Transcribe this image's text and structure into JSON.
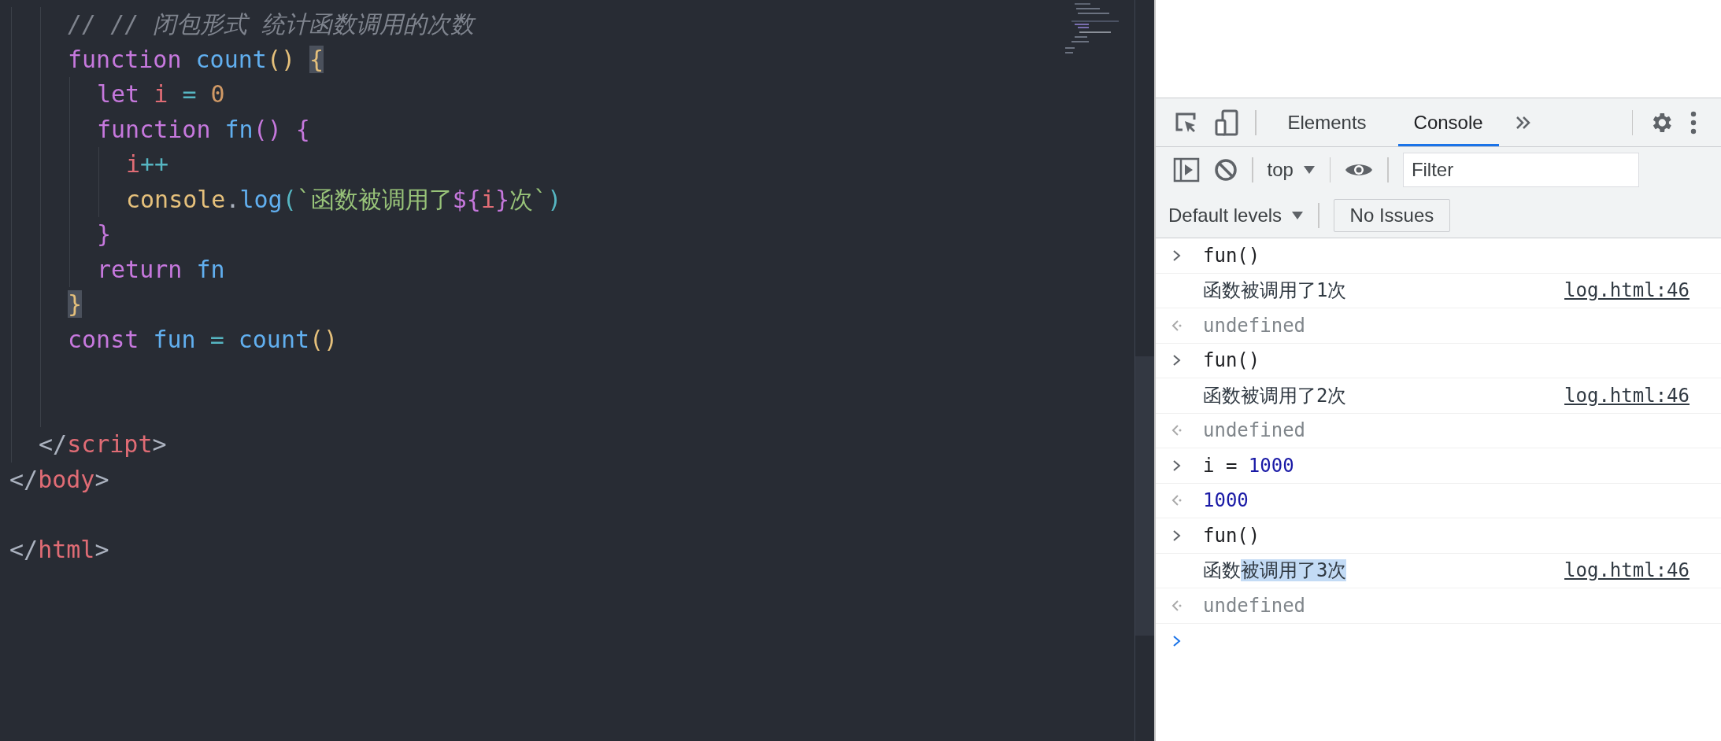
{
  "editor": {
    "lines": [
      {
        "kind": "group",
        "children": [
          {
            "kind": "group",
            "children": [
              {
                "kind": "code",
                "tokens": [
                  {
                    "text": "// // 闭包形式 统计函数调用的次数",
                    "kind": "comment"
                  }
                ]
              },
              {
                "kind": "code",
                "tokens": [
                  {
                    "text": "function ",
                    "kind": "keyword"
                  },
                  {
                    "text": "count",
                    "kind": "func"
                  },
                  {
                    "text": "() ",
                    "kind": "paren"
                  },
                  {
                    "text": "{",
                    "kind": "match"
                  }
                ],
                "children": [
                  {
                    "kind": "code",
                    "tokens": [
                      {
                        "text": "let ",
                        "kind": "keyword"
                      },
                      {
                        "text": "i ",
                        "kind": "var"
                      },
                      {
                        "text": "= ",
                        "kind": "op"
                      },
                      {
                        "text": "0",
                        "kind": "number"
                      }
                    ]
                  },
                  {
                    "kind": "code",
                    "tokens": [
                      {
                        "text": "function ",
                        "kind": "keyword"
                      },
                      {
                        "text": "fn",
                        "kind": "func"
                      },
                      {
                        "text": "() {",
                        "kind": "brace"
                      }
                    ],
                    "children": [
                      {
                        "kind": "code",
                        "tokens": [
                          {
                            "text": "i",
                            "kind": "var"
                          },
                          {
                            "text": "++",
                            "kind": "op"
                          }
                        ]
                      },
                      {
                        "kind": "code",
                        "tokens": [
                          {
                            "text": "console",
                            "kind": "object"
                          },
                          {
                            "text": ".",
                            "kind": "plain"
                          },
                          {
                            "text": "log",
                            "kind": "func"
                          },
                          {
                            "text": "(",
                            "kind": "op"
                          },
                          {
                            "text": "`函数被调用了",
                            "kind": "string"
                          },
                          {
                            "text": "${",
                            "kind": "keyword"
                          },
                          {
                            "text": "i",
                            "kind": "var"
                          },
                          {
                            "text": "}",
                            "kind": "keyword"
                          },
                          {
                            "text": "次`",
                            "kind": "string"
                          },
                          {
                            "text": ")",
                            "kind": "op"
                          }
                        ]
                      }
                    ]
                  },
                  {
                    "kind": "code",
                    "tokens": [
                      {
                        "text": "}",
                        "kind": "brace"
                      }
                    ]
                  },
                  {
                    "kind": "code",
                    "tokens": [
                      {
                        "text": "return ",
                        "kind": "keyword"
                      },
                      {
                        "text": "fn",
                        "kind": "func"
                      }
                    ]
                  }
                ]
              },
              {
                "kind": "code",
                "tokens": [
                  {
                    "text": "}",
                    "kind": "match"
                  }
                ]
              },
              {
                "kind": "code",
                "tokens": [
                  {
                    "text": "const ",
                    "kind": "keyword"
                  },
                  {
                    "text": "fun ",
                    "kind": "func"
                  },
                  {
                    "text": "= ",
                    "kind": "op"
                  },
                  {
                    "text": "count",
                    "kind": "func"
                  },
                  {
                    "text": "()",
                    "kind": "paren"
                  }
                ]
              },
              {
                "kind": "blank"
              },
              {
                "kind": "blank"
              }
            ]
          },
          {
            "kind": "code",
            "tokens": [
              {
                "text": "</",
                "kind": "plain"
              },
              {
                "text": "script",
                "kind": "tag"
              },
              {
                "text": ">",
                "kind": "plain"
              }
            ]
          }
        ]
      },
      {
        "kind": "code",
        "tokens": [
          {
            "text": "</",
            "kind": "plain"
          },
          {
            "text": "body",
            "kind": "tag"
          },
          {
            "text": ">",
            "kind": "plain"
          }
        ]
      },
      {
        "kind": "blank"
      },
      {
        "kind": "code",
        "tokens": [
          {
            "text": "</",
            "kind": "plain"
          },
          {
            "text": "html",
            "kind": "tag"
          },
          {
            "text": ">",
            "kind": "plain"
          }
        ]
      }
    ]
  },
  "devtools": {
    "tabs": [
      {
        "label": "Elements",
        "selected": false
      },
      {
        "label": "Console",
        "selected": true
      }
    ],
    "context": "top",
    "filter": {
      "placeholder": "Filter"
    },
    "levels": "Default levels",
    "issues": "No Issues",
    "console": [
      {
        "kind": "input",
        "tokens": [
          {
            "text": "fun()",
            "kind": "plain"
          }
        ]
      },
      {
        "kind": "log",
        "text": "函数被调用了1次",
        "source": "log.html:46"
      },
      {
        "kind": "result",
        "tokens": [
          {
            "text": "undefined",
            "kind": "undefined"
          }
        ]
      },
      {
        "kind": "input",
        "tokens": [
          {
            "text": "fun()",
            "kind": "plain"
          }
        ]
      },
      {
        "kind": "log",
        "text": "函数被调用了2次",
        "source": "log.html:46"
      },
      {
        "kind": "result",
        "tokens": [
          {
            "text": "undefined",
            "kind": "undefined"
          }
        ]
      },
      {
        "kind": "input",
        "tokens": [
          {
            "text": "i =",
            "kind": "plain"
          },
          {
            "text": "1000",
            "kind": "number"
          }
        ]
      },
      {
        "kind": "result",
        "tokens": [
          {
            "text": "1000",
            "kind": "number"
          }
        ]
      },
      {
        "kind": "input",
        "tokens": [
          {
            "text": "fun()",
            "kind": "plain"
          }
        ]
      },
      {
        "kind": "log",
        "text": "函数",
        "selected_text": "被调用了3次",
        "source": "log.html:46"
      },
      {
        "kind": "result",
        "tokens": [
          {
            "text": "undefined",
            "kind": "undefined"
          }
        ]
      },
      {
        "kind": "prompt"
      }
    ]
  }
}
